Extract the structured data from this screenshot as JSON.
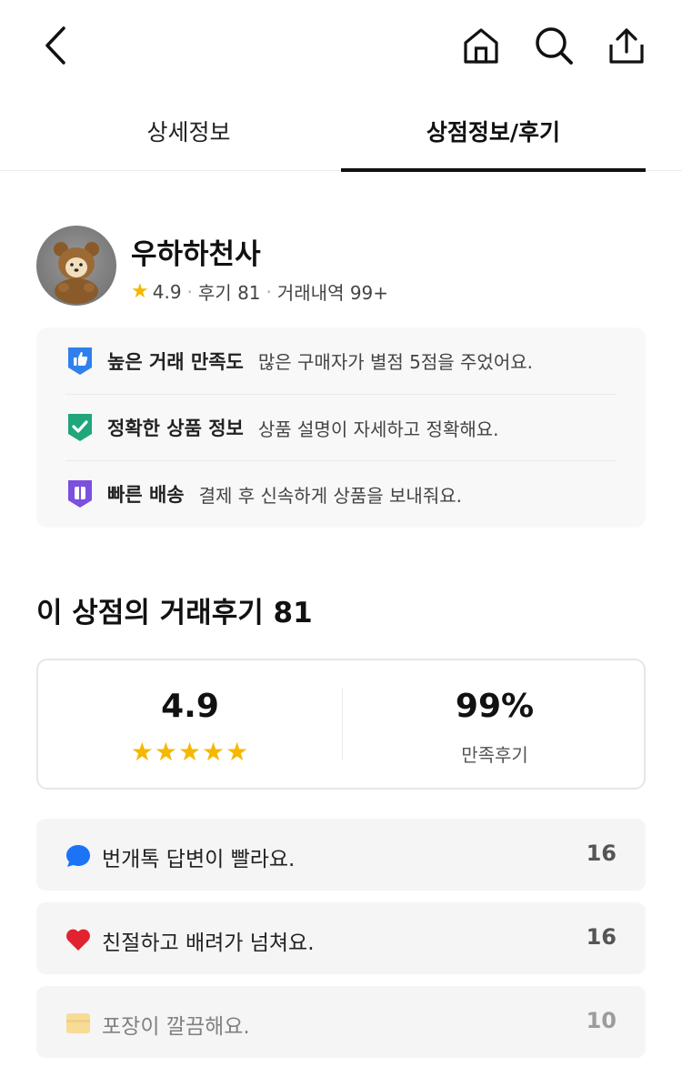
{
  "header": {
    "back_icon": "chevron-left-icon",
    "home_icon": "home-icon",
    "search_icon": "search-icon",
    "share_icon": "share-icon"
  },
  "tabs": [
    {
      "label": "상세정보",
      "active": false
    },
    {
      "label": "상점정보/후기",
      "active": true
    }
  ],
  "shop": {
    "name": "우하하천사",
    "rating": "4.9",
    "reviews": "후기 81",
    "trades": "거래내역 99+"
  },
  "badges": [
    {
      "icon": "thumbs-up-shield-icon",
      "color": "#2f80ed",
      "title": "높은 거래 만족도",
      "desc": "많은 구매자가 별점 5점을 주었어요."
    },
    {
      "icon": "check-shield-icon",
      "color": "#1fa67a",
      "title": "정확한 상품 정보",
      "desc": "상품 설명이 자세하고 정확해요."
    },
    {
      "icon": "box-shield-icon",
      "color": "#7b4fe0",
      "title": "빠른 배송",
      "desc": "결제 후 신속하게 상품을 보내줘요."
    }
  ],
  "reviews_section": {
    "title": "이 상점의 거래후기 81",
    "score": "4.9",
    "stars": "★★★★★",
    "satisfaction": "99%",
    "satisfaction_label": "만족후기"
  },
  "review_tags": [
    {
      "icon": "chat-bubble-icon",
      "color": "#1b74f5",
      "text": "번개톡 답변이 빨라요.",
      "count": "16"
    },
    {
      "icon": "heart-icon",
      "color": "#e0232e",
      "text": "친절하고 배려가 넘쳐요.",
      "count": "16"
    },
    {
      "icon": "package-icon",
      "color": "#f7c948",
      "text": "포장이 깔끔해요.",
      "count": "10"
    }
  ],
  "colors": {
    "star": "#f5b800",
    "tab_indicator": "#111111",
    "card_bg": "#f8f8f8"
  }
}
